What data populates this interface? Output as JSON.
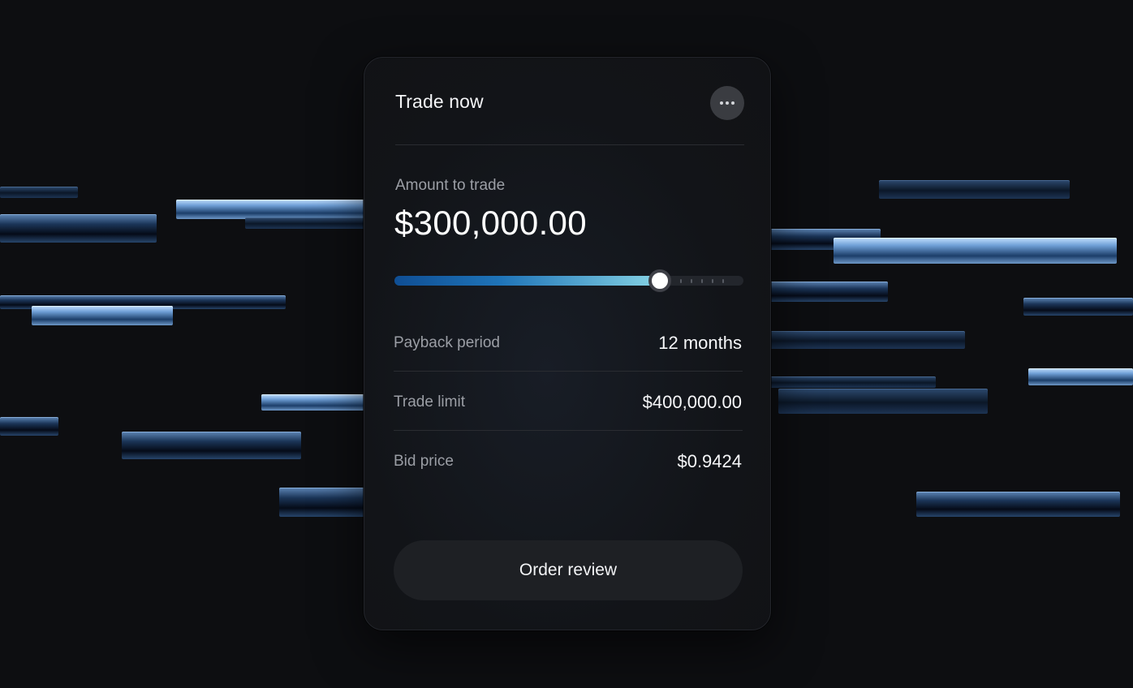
{
  "card": {
    "title": "Trade now",
    "more_icon": "more-horizontal-icon"
  },
  "amount": {
    "label": "Amount to trade",
    "value": "$300,000.00",
    "slider_fraction": 0.76
  },
  "details": [
    {
      "label": "Payback period",
      "value": "12 months"
    },
    {
      "label": "Trade limit",
      "value": "$400,000.00"
    },
    {
      "label": "Bid price",
      "value": "$0.9424"
    }
  ],
  "actions": {
    "order_review_label": "Order review"
  },
  "colors": {
    "background": "#0d0e11",
    "card": "#121418",
    "accent_start": "#0f4e94",
    "accent_end": "#86d3e4",
    "button": "#1e2024"
  }
}
